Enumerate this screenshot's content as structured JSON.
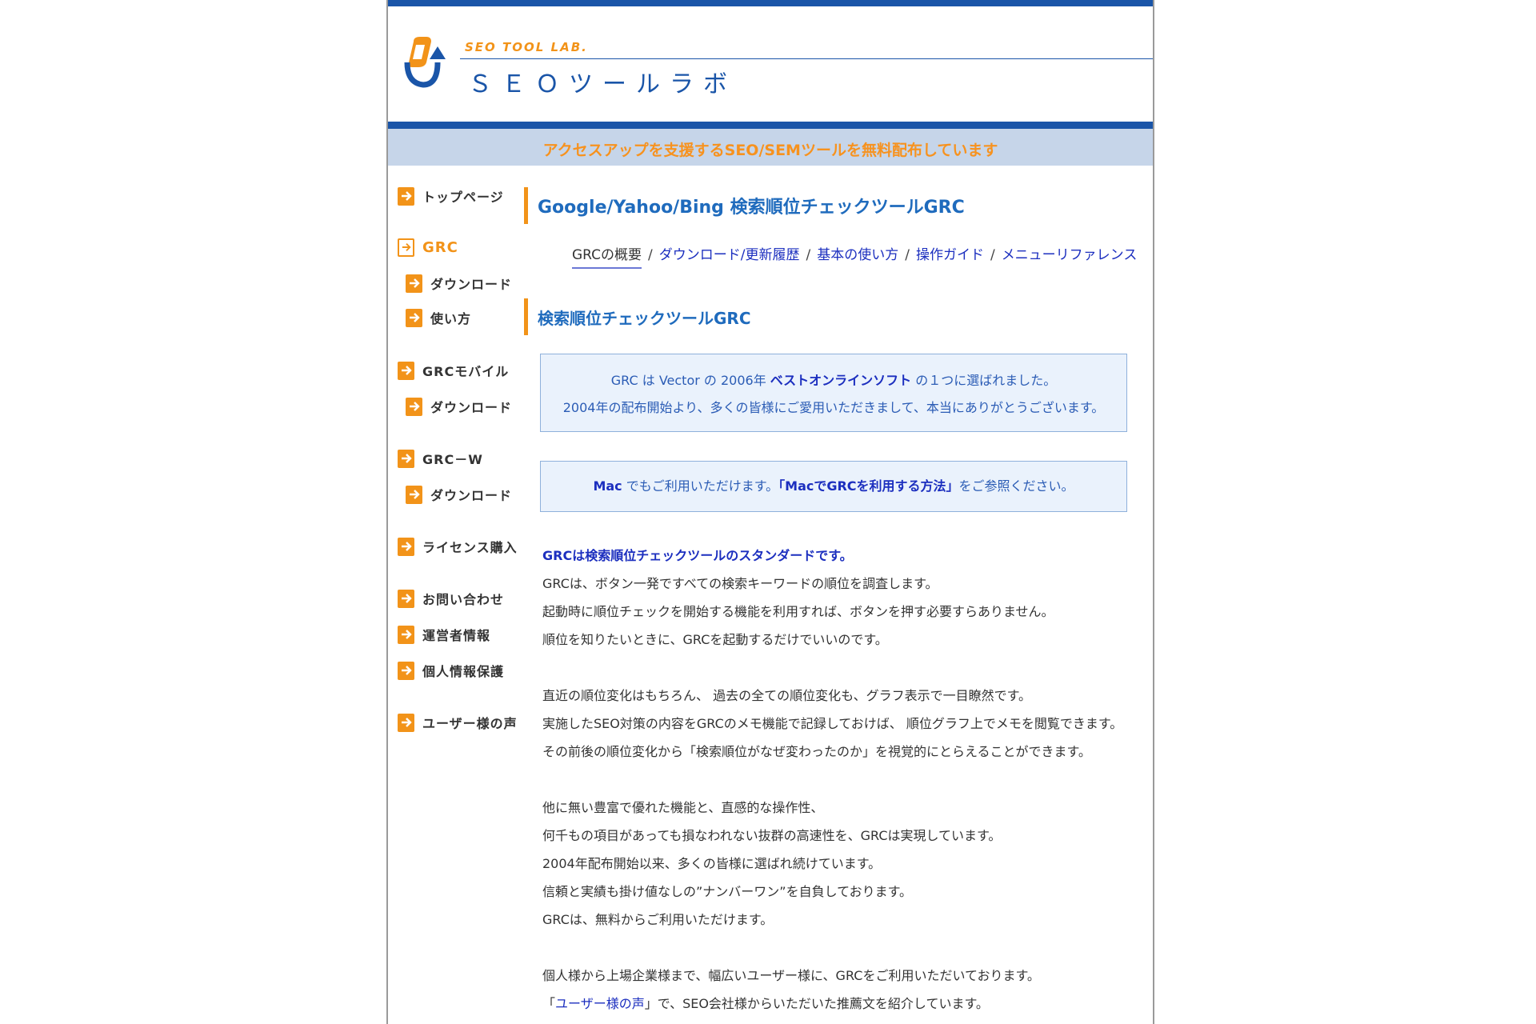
{
  "header": {
    "logo_small": "SEO TOOL LAB.",
    "logo_big": "ＳＥＯツールラボ",
    "tagline": "アクセスアップを支援するSEO/SEMツールを無料配布しています"
  },
  "sidebar": {
    "items": [
      {
        "label": "トップページ"
      },
      {
        "label": "GRC"
      },
      {
        "label": "ダウンロード"
      },
      {
        "label": "使い方"
      },
      {
        "label": "GRCモバイル"
      },
      {
        "label": "ダウンロード"
      },
      {
        "label": "GRC－W"
      },
      {
        "label": "ダウンロード"
      },
      {
        "label": "ライセンス購入"
      },
      {
        "label": "お問い合わせ"
      },
      {
        "label": "運営者情報"
      },
      {
        "label": "個人情報保護"
      },
      {
        "label": "ユーザー様の声"
      }
    ]
  },
  "main": {
    "page_title": "Google/Yahoo/Bing 検索順位チェックツールGRC",
    "tabs": {
      "overview": "GRCの概要",
      "download": "ダウンロード/更新履歴",
      "basics": "基本の使い方",
      "guide": "操作ガイド",
      "reference": "メニューリファレンス",
      "sep": "/"
    },
    "section_title": "検索順位チェックツールGRC",
    "award": {
      "line1_pre": "GRC は Vector の 2006年 ",
      "line1_bold": "ベストオンラインソフト",
      "line1_post": " の１つに選ばれました。",
      "line2": "2004年の配布開始より、多くの皆様にご愛用いただきまして、本当にありがとうございます。"
    },
    "mac": {
      "pre_bold": "Mac",
      "pre": " でもご利用いただけます。",
      "link": "「MacでGRCを利用する方法」",
      "post": "をご参照ください。"
    },
    "lead": "GRCは検索順位チェックツールのスタンダードです。",
    "paragraphs": [
      [
        "GRCは、ボタン一発ですべての検索キーワードの順位を調査します。",
        "起動時に順位チェックを開始する機能を利用すれば、ボタンを押す必要すらありません。",
        "順位を知りたいときに、GRCを起動するだけでいいのです。"
      ],
      [
        "直近の順位変化はもちろん、 過去の全ての順位変化も、グラフ表示で一目瞭然です。",
        "実施したSEO対策の内容をGRCのメモ機能で記録しておけば、 順位グラフ上でメモを閲覧できます。",
        "その前後の順位変化から「検索順位がなぜ変わったのか」を視覚的にとらえることができます。"
      ],
      [
        "他に無い豊富で優れた機能と、直感的な操作性、",
        "何千もの項目があっても損なわれない抜群の高速性を、GRCは実現しています。",
        "2004年配布開始以来、多くの皆様に選ばれ続けています。",
        "信頼と実績も掛け値なしの”ナンバーワン”を自負しております。",
        "GRCは、無料からご利用いただけます。"
      ],
      [
        "個人様から上場企業様まで、幅広いユーザー様に、GRCをご利用いただいております。"
      ]
    ],
    "voice": {
      "open": "「",
      "link": "ユーザー様の声",
      "close": "」で、SEO会社様からいただいた推薦文を紹介しています。"
    }
  },
  "colors": {
    "brand_blue": "#1a55a8",
    "accent_orange": "#f29319",
    "tagline_bg": "#c6d5e9",
    "infobox_bg": "#eaf2fc",
    "link": "#1c2fbf"
  }
}
